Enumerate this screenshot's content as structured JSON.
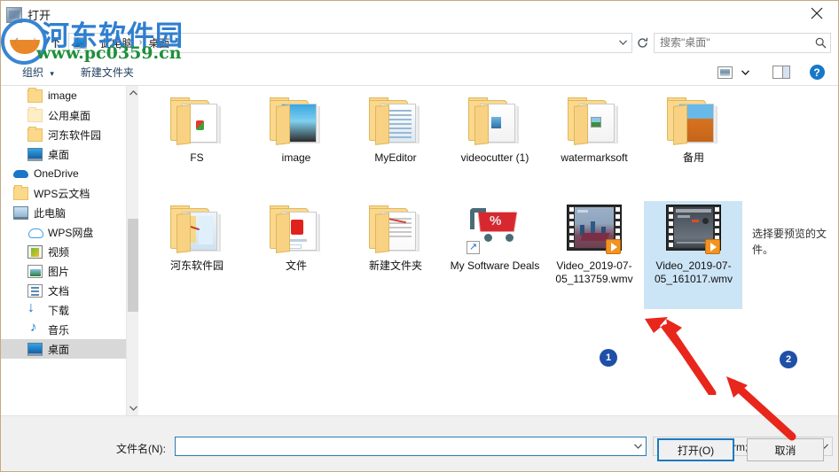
{
  "window": {
    "title": "打开",
    "close_label": "✕",
    "icon": "app-icon"
  },
  "navigation": {
    "back_icon": "chevron-left-icon",
    "forward_icon": "chevron-right-icon",
    "up_icon": "arrow-up-icon",
    "refresh_icon": "refresh-icon",
    "breadcrumbs": [
      "此电脑",
      "桌面"
    ],
    "breadcrumb_separator": "›",
    "dropdown_icon": "chevron-down-icon"
  },
  "search": {
    "placeholder": "搜索\"桌面\"",
    "value": "",
    "icon": "search-icon"
  },
  "toolbar": {
    "organize_label": "组织",
    "organize_caret": "▾",
    "new_folder_label": "新建文件夹",
    "view_icon": "view-layout-icon",
    "view_caret": "▾",
    "preview_pane_icon": "preview-pane-icon",
    "help_label": "?"
  },
  "sidebar": {
    "items": [
      {
        "label": "image",
        "icon": "folder-icon",
        "level": 1,
        "selected": false
      },
      {
        "label": "公用桌面",
        "icon": "folder-pale-icon",
        "level": 1,
        "selected": false
      },
      {
        "label": "河东软件园",
        "icon": "folder-icon",
        "level": 1,
        "selected": false
      },
      {
        "label": "桌面",
        "icon": "monitor-icon",
        "level": 1,
        "selected": false
      },
      {
        "label": "OneDrive",
        "icon": "onedrive-cloud-icon",
        "level": 0,
        "selected": false
      },
      {
        "label": "WPS云文档",
        "icon": "folder-icon",
        "level": 0,
        "selected": false
      },
      {
        "label": "此电脑",
        "icon": "this-pc-icon",
        "level": 0,
        "selected": false
      },
      {
        "label": "WPS网盘",
        "icon": "wps-cloud-icon",
        "level": 1,
        "selected": false
      },
      {
        "label": "视频",
        "icon": "video-icon",
        "level": 1,
        "selected": false
      },
      {
        "label": "图片",
        "icon": "picture-icon",
        "level": 1,
        "selected": false
      },
      {
        "label": "文档",
        "icon": "document-icon",
        "level": 1,
        "selected": false
      },
      {
        "label": "下载",
        "icon": "download-icon",
        "level": 1,
        "selected": false
      },
      {
        "label": "音乐",
        "icon": "music-icon",
        "level": 1,
        "selected": false
      },
      {
        "label": "桌面",
        "icon": "monitor-icon",
        "level": 1,
        "selected": true
      }
    ],
    "scroll_up_icon": "chevron-up-icon",
    "scroll_down_icon": "chevron-down-icon"
  },
  "files": {
    "row1": [
      {
        "name": "FS",
        "type": "folder"
      },
      {
        "name": "image",
        "type": "folder"
      },
      {
        "name": "MyEditor",
        "type": "folder"
      },
      {
        "name": "videocutter (1)",
        "type": "folder"
      },
      {
        "name": "watermarksoft",
        "type": "folder"
      },
      {
        "name": "备用",
        "type": "folder"
      }
    ],
    "row2": [
      {
        "name": "河东软件园",
        "type": "folder"
      },
      {
        "name": "文件",
        "type": "folder"
      },
      {
        "name": "新建文件夹",
        "type": "folder"
      },
      {
        "name": "My Software Deals",
        "type": "shortcut"
      },
      {
        "name": "Video_2019-07-05_113759.wmv",
        "type": "video",
        "selected": false
      },
      {
        "name": "Video_2019-07-05_161017.wmv",
        "type": "video",
        "selected": true
      }
    ]
  },
  "preview": {
    "message": "选择要预览的文件。"
  },
  "footer": {
    "filename_label": "文件名(N):",
    "filename_value": "",
    "filename_dropdown_icon": "chevron-down-icon",
    "filter_text": "所有媒体文件(*.rm;*.rmvb;*.fl",
    "filter_dropdown_icon": "chevron-down-icon",
    "open_button": "打开(O)",
    "cancel_button": "取消"
  },
  "annotations": {
    "badge1": "1",
    "badge2": "2",
    "arrow_color": "#e8261c"
  },
  "watermark": {
    "line1": "河东软件园",
    "line2": "www.pc0359.cn"
  },
  "colors": {
    "accent": "#1a7ac0",
    "selection": "#cce5f6",
    "folder": "#fbd88c",
    "badge": "#1f4fa8",
    "arrow": "#e8261c"
  }
}
